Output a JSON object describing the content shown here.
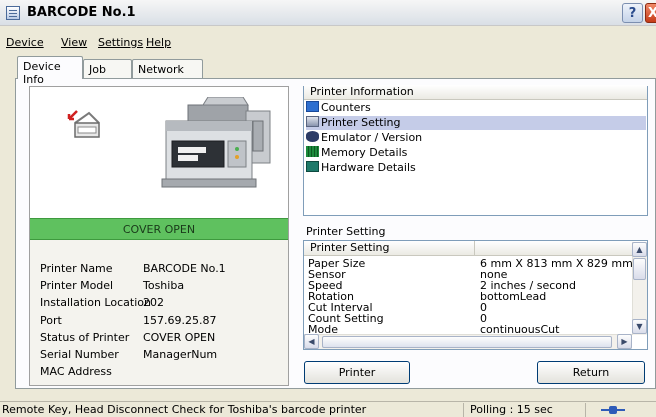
{
  "window": {
    "title": "BARCODE No.1",
    "help_label": "?",
    "close_label": "X"
  },
  "menu": [
    {
      "label": "Device",
      "hotkey": "D"
    },
    {
      "label": "View",
      "hotkey": "V"
    },
    {
      "label": "Settings",
      "hotkey": "S"
    },
    {
      "label": "Help",
      "hotkey": "H"
    }
  ],
  "tabs": [
    "Device Info",
    "Job Info",
    "Network Info"
  ],
  "device": {
    "status_banner": "COVER OPEN",
    "info": [
      {
        "label": "Printer Name",
        "value": "BARCODE No.1"
      },
      {
        "label": "Printer Model",
        "value": "Toshiba"
      },
      {
        "label": "Installation Location",
        "value": "202"
      },
      {
        "label": "Port",
        "value": "157.69.25.87"
      },
      {
        "label": "Status of Printer",
        "value": "COVER OPEN"
      },
      {
        "label": "Serial Number",
        "value": "ManagerNum"
      },
      {
        "label": "MAC Address",
        "value": ""
      }
    ]
  },
  "printer_information": {
    "header": "Printer Information",
    "items": [
      {
        "label": "Counters",
        "icon": "counters-icon",
        "color": "#2E6FD0"
      },
      {
        "label": "Printer Setting",
        "icon": "printer-setting-icon",
        "color": "#6B7FA8"
      },
      {
        "label": "Emulator / Version",
        "icon": "emulator-icon",
        "color": "#2C3C66"
      },
      {
        "label": "Memory Details",
        "icon": "memory-icon",
        "color": "#1C8A3C"
      },
      {
        "label": "Hardware Details",
        "icon": "hardware-icon",
        "color": "#1E7A6A"
      }
    ],
    "selected_index": 1
  },
  "printer_setting": {
    "label": "Printer Setting",
    "header": "Printer Setting",
    "rows": [
      {
        "key": "Paper Size",
        "value": "6 mm X 813 mm X 829 mm"
      },
      {
        "key": "Sensor",
        "value": "none"
      },
      {
        "key": "Speed",
        "value": "2 inches / second"
      },
      {
        "key": "Rotation",
        "value": "bottomLead"
      },
      {
        "key": "Cut Interval",
        "value": "0"
      },
      {
        "key": "Count Setting",
        "value": "0"
      },
      {
        "key": "Mode",
        "value": "continuousCut"
      }
    ]
  },
  "buttons": {
    "printer": "Printer",
    "return": "Return"
  },
  "statusbar": {
    "message": "Remote Key, Head Disconnect Check for Toshiba's barcode printer",
    "polling": "Polling : 15 sec"
  },
  "colors": {
    "banner_green": "#5FC15F",
    "selection": "#C5CCE8"
  }
}
